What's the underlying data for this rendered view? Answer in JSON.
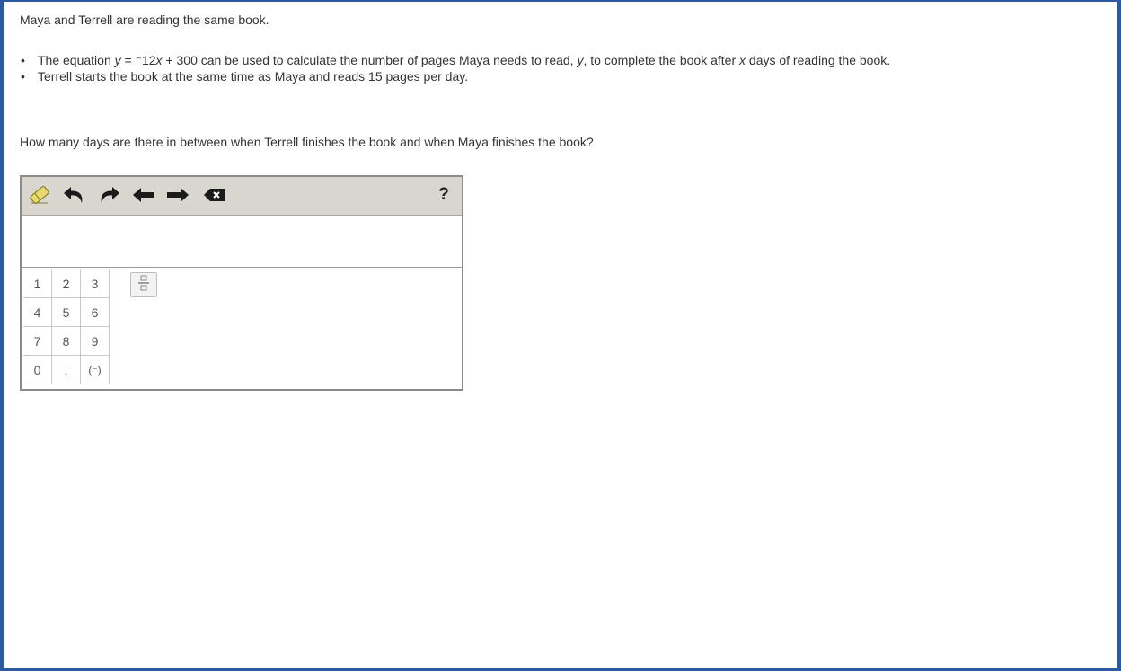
{
  "problem": {
    "intro": "Maya and Terrell are reading the same book.",
    "bullet1": {
      "before": "The equation ",
      "var_y": "y",
      "mid": " = ⁻12",
      "var_x": "x",
      "after": " + 300 can be used to calculate the number of pages Maya needs to read, ",
      "var_y2": "y",
      "after2": ", to complete the book after ",
      "var_x2": "x",
      "after3": " days of reading the book."
    },
    "bullet2": "Terrell starts the book at the same time as Maya and reads 15 pages per day.",
    "question": "How many days are there in between when Terrell finishes the book and when Maya finishes the book?"
  },
  "editor": {
    "help_label": "?",
    "answer_value": "",
    "keys": {
      "k1": "1",
      "k2": "2",
      "k3": "3",
      "k4": "4",
      "k5": "5",
      "k6": "6",
      "k7": "7",
      "k8": "8",
      "k9": "9",
      "k0": "0",
      "kdot": ".",
      "kneg": "(⁻)"
    },
    "colors": {
      "frame_border": "#2c5aa0",
      "toolbar_bg": "#d9d6cf",
      "eraser": "#e8d96a"
    }
  }
}
